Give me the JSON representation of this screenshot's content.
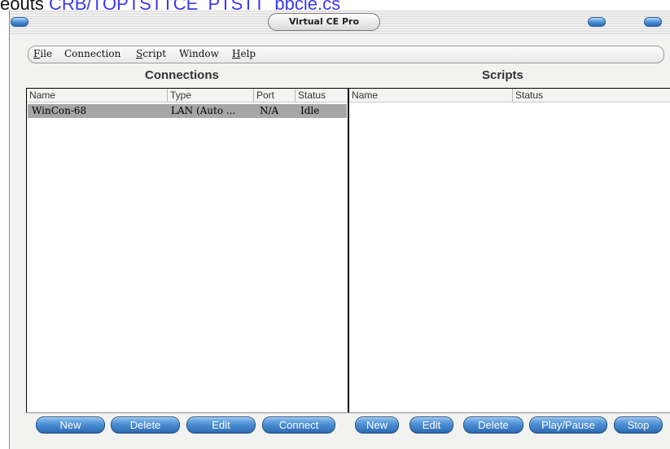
{
  "top_strip": {
    "lead_text": "eouts",
    "link_text": "CRB/TQPTSTTCE_PTSTT_ppcle.cs"
  },
  "window": {
    "title": "Virtual CE Pro"
  },
  "menu": [
    {
      "label_first": "F",
      "label_rest": "ile"
    },
    {
      "label_first": "",
      "label_rest": "Connection"
    },
    {
      "label_first": "S",
      "label_rest": "cript"
    },
    {
      "label_first": "",
      "label_rest": "Window"
    },
    {
      "label_first": "H",
      "label_rest": "elp"
    }
  ],
  "connections": {
    "title": "Connections",
    "columns": [
      "Name",
      "Type",
      "Port",
      "Status"
    ],
    "rows": [
      {
        "name": "WinCon-68",
        "type": "LAN (Auto ...",
        "port": "N/A",
        "status": "Idle"
      }
    ],
    "buttons": [
      "New",
      "Delete",
      "Edit",
      "Connect"
    ]
  },
  "scripts": {
    "title": "Scripts",
    "columns": [
      "Name",
      "Status"
    ],
    "rows": [],
    "buttons": [
      "New",
      "Edit",
      "Delete",
      "Play/Pause",
      "Stop"
    ]
  },
  "colors": {
    "button_blue": "#3e7fc6",
    "selected_row": "#a6a6a6"
  }
}
